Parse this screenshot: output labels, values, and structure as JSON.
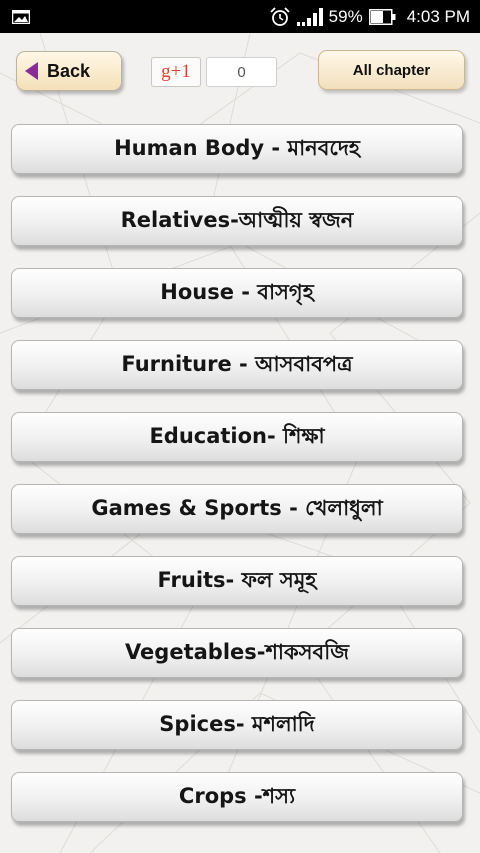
{
  "status_bar": {
    "battery": "59%",
    "time": "4:03 PM"
  },
  "toolbar": {
    "back_label": "Back",
    "gplus_label": "g+1",
    "share_count": "0",
    "all_chapter_label": "All chapter"
  },
  "chapters": [
    {
      "label": "Human Body - মানবদেহ"
    },
    {
      "label": "Relatives-আত্মীয় স্বজন"
    },
    {
      "label": "House - বাসগৃহ"
    },
    {
      "label": "Furniture - আসবাবপত্র"
    },
    {
      "label": "Education- শিক্ষা"
    },
    {
      "label": "Games & Sports - খেলাধুলা"
    },
    {
      "label": "Fruits- ফল সমূহ"
    },
    {
      "label": "Vegetables-শাকসবজি"
    },
    {
      "label": "Spices- মশলাদি"
    },
    {
      "label": "Crops -শস্য"
    }
  ],
  "colors": {
    "status_bar_bg": "#000000",
    "back_arrow": "#8b2b96",
    "gplus_red": "#d8432e",
    "page_bg": "#f2f1ef"
  }
}
